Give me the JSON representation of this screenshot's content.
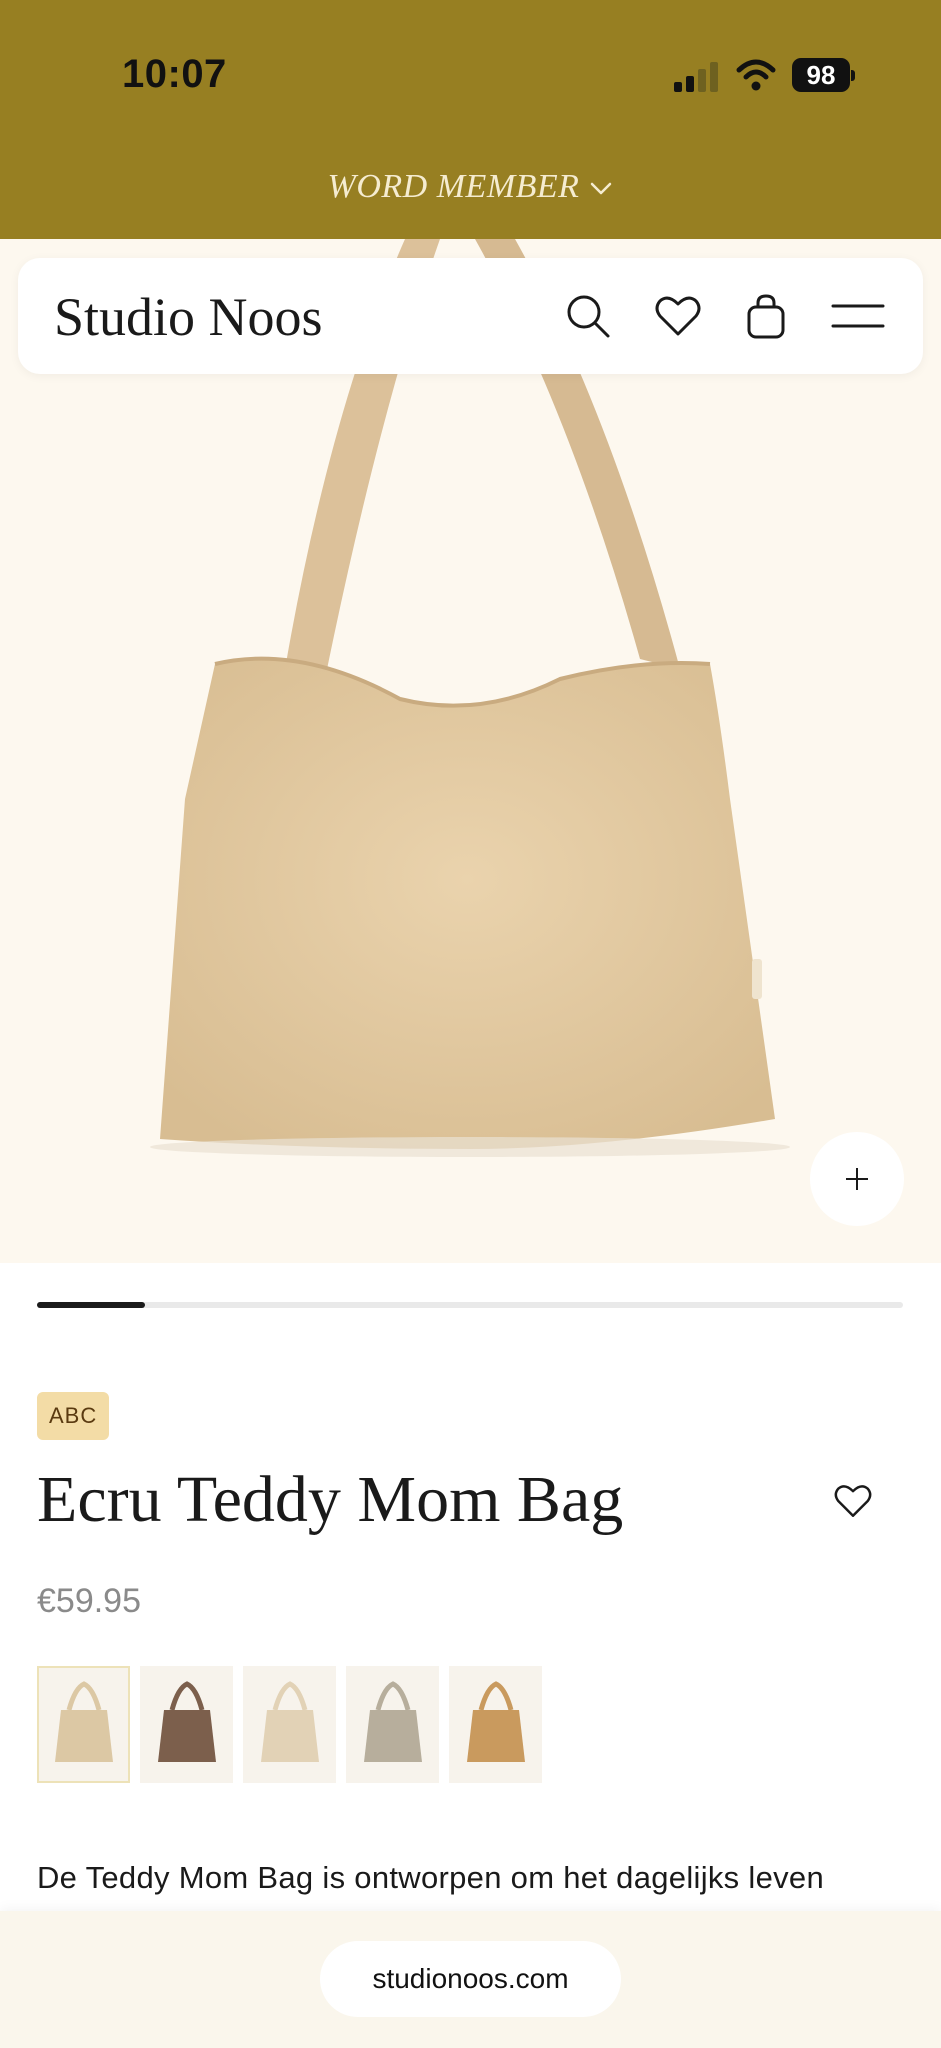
{
  "status_bar": {
    "time": "10:07",
    "battery": "98"
  },
  "promo": {
    "label": "WORD MEMBER"
  },
  "header": {
    "brand": "Studio Noos"
  },
  "gallery": {
    "progress": 0.125
  },
  "product": {
    "badge": "ABC",
    "title": "Ecru Teddy Mom Bag",
    "price": "€59.95",
    "description": "De Teddy Mom Bag is ontworpen om het dagelijks leven",
    "variants": [
      {
        "name": "ecru-teddy",
        "color": "#dcc8a4"
      },
      {
        "name": "brown-teddy",
        "color": "#7c5f4c"
      },
      {
        "name": "ecru-brown-strap",
        "color": "#e2d2b6"
      },
      {
        "name": "leopard-grey",
        "color": "#b7ae9c"
      },
      {
        "name": "leopard-camel",
        "color": "#c99a5e"
      }
    ]
  },
  "browser": {
    "url": "studionoos.com"
  },
  "colors": {
    "topbar": "#977f22",
    "hero_bg": "#fdf8ef",
    "badge_bg": "#f3dca6",
    "bag": "#e2c9a2"
  }
}
